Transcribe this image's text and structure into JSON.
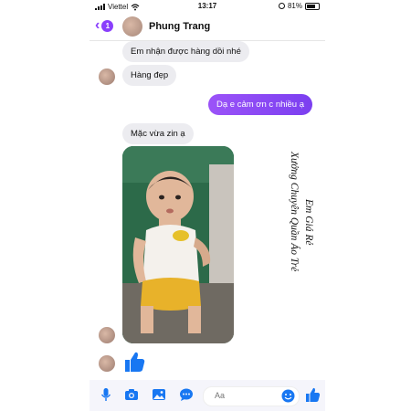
{
  "status": {
    "carrier": "Viettel",
    "time": "13:17",
    "battery": "81%"
  },
  "header": {
    "back_badge": "1",
    "contact_name": "Phung Trang"
  },
  "messages": [
    {
      "text": "Em nhận được hàng dồi nhé",
      "direction": "incoming"
    },
    {
      "text": "Hàng đẹp",
      "direction": "incoming"
    },
    {
      "text": "Dạ e cảm ơn c nhiều ạ",
      "direction": "outgoing"
    },
    {
      "text": "Mặc vừa zin ạ",
      "direction": "incoming"
    }
  ],
  "watermark": {
    "line1": "Xưởng Chuyên Quần Áo Trẻ",
    "line2": "Em Giá Rẻ"
  },
  "composer": {
    "placeholder": "Aa"
  },
  "colors": {
    "accent": "#8a3ffc",
    "messenger_blue": "#1877f2",
    "incoming_bubble": "#ececf0"
  }
}
